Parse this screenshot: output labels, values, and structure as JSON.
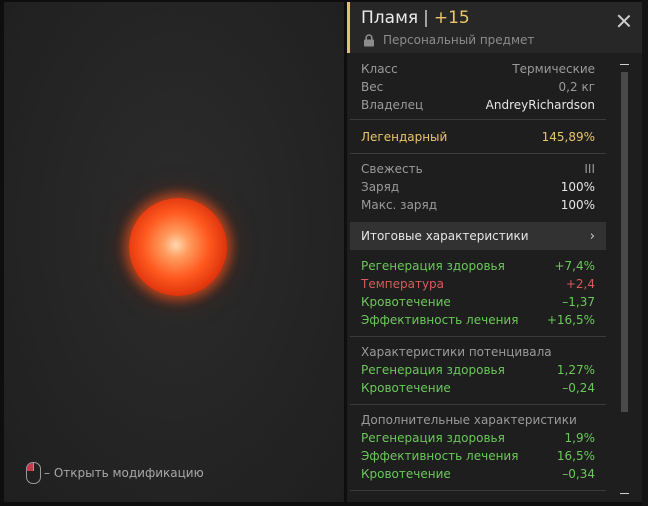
{
  "viewer": {
    "hint_text": "– Открыть модификацию"
  },
  "item": {
    "name": "Пламя",
    "separator": "|",
    "level": "+15",
    "subtitle": "Персональный предмет"
  },
  "info": [
    {
      "label": "Класс",
      "value": "Термические"
    },
    {
      "label": "Вес",
      "value": "0,2 кг"
    },
    {
      "label": "Владелец",
      "value": "AndreyRichardson"
    }
  ],
  "rarity": {
    "label": "Легендарный",
    "value": "145,89%"
  },
  "condition": [
    {
      "label": "Свежесть",
      "value": "III"
    },
    {
      "label": "Заряд",
      "value": "100%"
    },
    {
      "label": "Макс. заряд",
      "value": "100%"
    }
  ],
  "summary_button": {
    "label": "Итоговые характеристики",
    "chevron": "›"
  },
  "main_stats": [
    {
      "label": "Регенерация здоровья",
      "value": "+7,4%",
      "tone": "good"
    },
    {
      "label": "Температура",
      "value": "+2,4",
      "tone": "bad"
    },
    {
      "label": "Кровотечение",
      "value": "–1,37",
      "tone": "good"
    },
    {
      "label": "Эффективность лечения",
      "value": "+16,5%",
      "tone": "good"
    }
  ],
  "potential": {
    "title": "Характеристики потенцивала",
    "stats": [
      {
        "label": "Регенерация здоровья",
        "value": "1,27%"
      },
      {
        "label": "Кровотечение",
        "value": "–0,24"
      }
    ]
  },
  "additional": {
    "title": "Дополнительные характеристики",
    "stats": [
      {
        "label": "Регенерация здоровья",
        "value": "1,9%"
      },
      {
        "label": "Эффективность лечения",
        "value": "16,5%"
      },
      {
        "label": "Кровотечение",
        "value": "–0,34"
      }
    ]
  },
  "colors": {
    "accent_gold": "#e8c56e",
    "positive": "#6bc85a",
    "negative": "#d85a5a"
  }
}
